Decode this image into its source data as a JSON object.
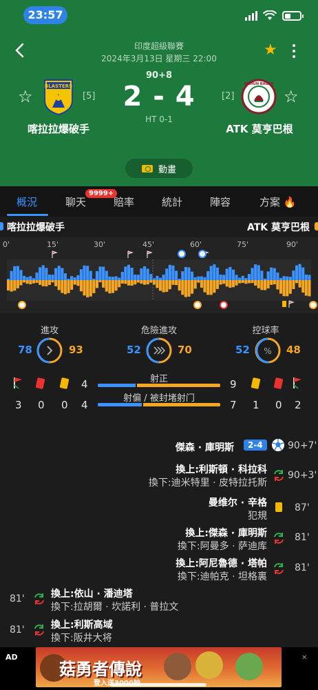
{
  "status_bar": {
    "time": "23:57"
  },
  "header": {
    "league": "印度超級聯賽",
    "datetime": "2024年3月13日 星期三 22:00",
    "minute": "90+8",
    "score": "2 - 4",
    "half_time": "HT 0-1",
    "home": {
      "name": "喀拉拉爆破手",
      "rank": "[5]",
      "logo_text": "BLASTERS"
    },
    "away": {
      "name": "ATK 莫亨巴根",
      "rank": "[2]",
      "logo_text": "MOHUN BAGAN"
    },
    "animation_label": "動畫"
  },
  "tabs": [
    {
      "label": "概況",
      "active": true
    },
    {
      "label": "聊天",
      "badge": "9999+"
    },
    {
      "label": "賠率"
    },
    {
      "label": "統計"
    },
    {
      "label": "陣容"
    },
    {
      "label": "方案"
    }
  ],
  "timeline": {
    "home_label": "喀拉拉爆破手",
    "away_label": "ATK 莫亨巴根",
    "ticks": [
      "0'",
      "15'",
      "30'",
      "45'",
      "60'",
      "75'",
      "90'"
    ]
  },
  "stats": {
    "attack": {
      "label": "進攻",
      "home": "78",
      "away": "93"
    },
    "dangerous": {
      "label": "危險進攻",
      "home": "52",
      "away": "70"
    },
    "possession": {
      "label": "控球率",
      "home": "52",
      "away": "48"
    },
    "on_target": {
      "label": "射正",
      "home": "4",
      "away": "9",
      "home_share": 0.31
    },
    "off_target": {
      "label": "射偏 / 被封堵射门",
      "home": "4",
      "away": "7",
      "home_share": 0.36
    },
    "home_cards": {
      "corners": "3",
      "red": "0",
      "yellow": "0"
    },
    "away_cards": {
      "yellow": "1",
      "red": "0",
      "corners": "2"
    }
  },
  "events": [
    {
      "side": "away",
      "type": "goal",
      "main": "傑森 · 庫明斯",
      "score": "2-4",
      "time": "90+7'"
    },
    {
      "side": "away",
      "type": "sub",
      "main": "換上:利斯頓 · 科拉科",
      "sub": "換下:迪米特里 · 皮特拉托斯",
      "time": "90+3'"
    },
    {
      "side": "away",
      "type": "yellow",
      "main": "曼维尔 · 辛格",
      "sub": "犯規",
      "time": "87'"
    },
    {
      "side": "away",
      "type": "sub",
      "main": "換上:傑森 · 庫明斯",
      "sub": "換下:阿曼多 · 萨迪库",
      "time": "81'"
    },
    {
      "side": "away",
      "type": "sub",
      "main": "換上:阿尼魯德 · 塔帕",
      "sub": "換下:迪帕克 · 坦格裏",
      "time": "81'"
    },
    {
      "side": "home",
      "type": "sub",
      "main": "換上:依山 · 潘迪塔",
      "sub": "換下:拉胡爾 · 坎諾利 · 普拉文",
      "time": "81'"
    },
    {
      "side": "home",
      "type": "sub",
      "main": "換上:利斯高域",
      "sub": "換下:阪井大将",
      "time": "81'"
    }
  ],
  "ad": {
    "label": "AD",
    "title": "菇勇者傳說",
    "subtitle": "登入送3000抽"
  },
  "colors": {
    "header_green": "#1e7a3c",
    "home_blue": "#3a93ff",
    "away_orange": "#f5a623",
    "accent_yellow": "#f5b800"
  }
}
